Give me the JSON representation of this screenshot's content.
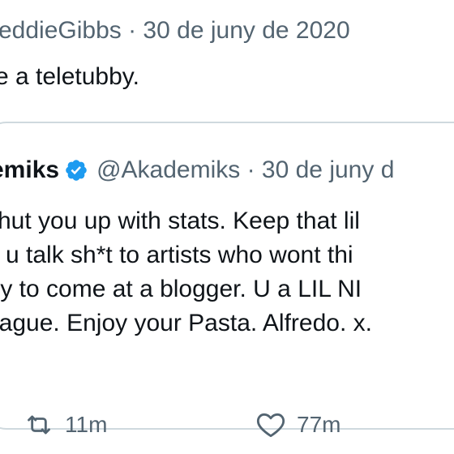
{
  "tweet": {
    "author_line": "eddieGibbs · 30 de juny de 2020",
    "text": "e a teletubby."
  },
  "quoted_tweet": {
    "name": "emiks",
    "handle_and_date": "@Akademiks · 30 de juny d",
    "lines": [
      "shut you up with stats. Keep that lil",
      "e u talk sh*t to artists who wont thi",
      "try to come at a blogger. U a LIL NI",
      "eague. Enjoy your Pasta. Alfredo. x."
    ]
  },
  "actions": {
    "retweet_count": "11m",
    "like_count": "77m"
  },
  "icons": {
    "verified": "verified-badge-icon",
    "retweet": "retweet-icon",
    "like": "heart-icon"
  },
  "colors": {
    "primary_text": "#0f1419",
    "secondary_text": "#536471",
    "verified_blue": "#1d9bf0",
    "border": "#cfd9de"
  }
}
